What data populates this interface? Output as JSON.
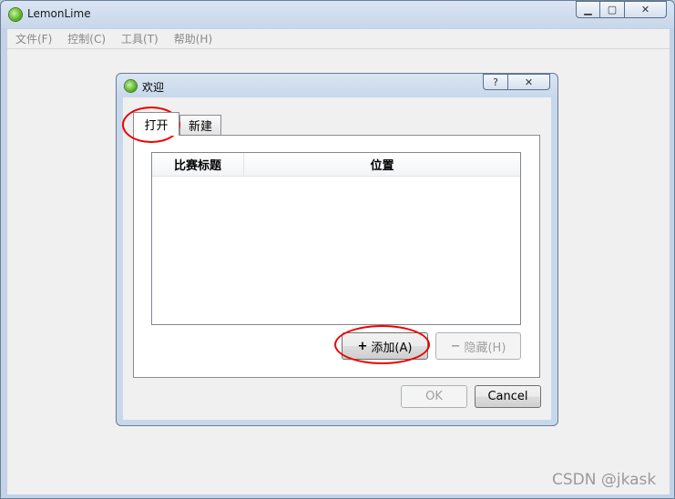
{
  "window": {
    "title": "LemonLime",
    "menu": [
      "文件(F)",
      "控制(C)",
      "工具(T)",
      "帮助(H)"
    ]
  },
  "dialog": {
    "title": "欢迎",
    "help_label": "?",
    "tabs": [
      "打开",
      "新建"
    ],
    "table": {
      "columns": [
        "比赛标题",
        "位置"
      ],
      "rows": []
    },
    "add_button": "添加(A)",
    "hide_button": "隐藏(H)",
    "ok_button": "OK",
    "cancel_button": "Cancel"
  },
  "watermark": "CSDN @jkask",
  "icons": {
    "app": "lime-icon",
    "add": "plus-icon",
    "hide": "minus-icon"
  },
  "colors": {
    "annotation": "#e00000",
    "window_frame": "#c3d2e6"
  }
}
